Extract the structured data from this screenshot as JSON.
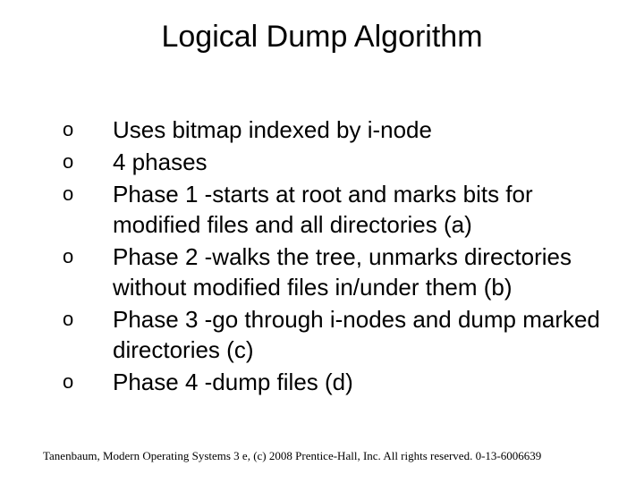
{
  "title": "Logical Dump Algorithm",
  "bullet_marker": "o",
  "items": [
    "Uses bitmap indexed by i-node",
    "4 phases",
    "Phase 1 -starts at root and marks bits for modified files and all directories (a)",
    "Phase 2 -walks the tree, unmarks directories without modified files in/under them (b)",
    "Phase 3 -go through i-nodes and dump marked directories (c)",
    "Phase 4 -dump files (d)"
  ],
  "footer": "Tanenbaum, Modern Operating Systems 3 e, (c) 2008 Prentice-Hall, Inc. All rights reserved. 0-13-6006639"
}
